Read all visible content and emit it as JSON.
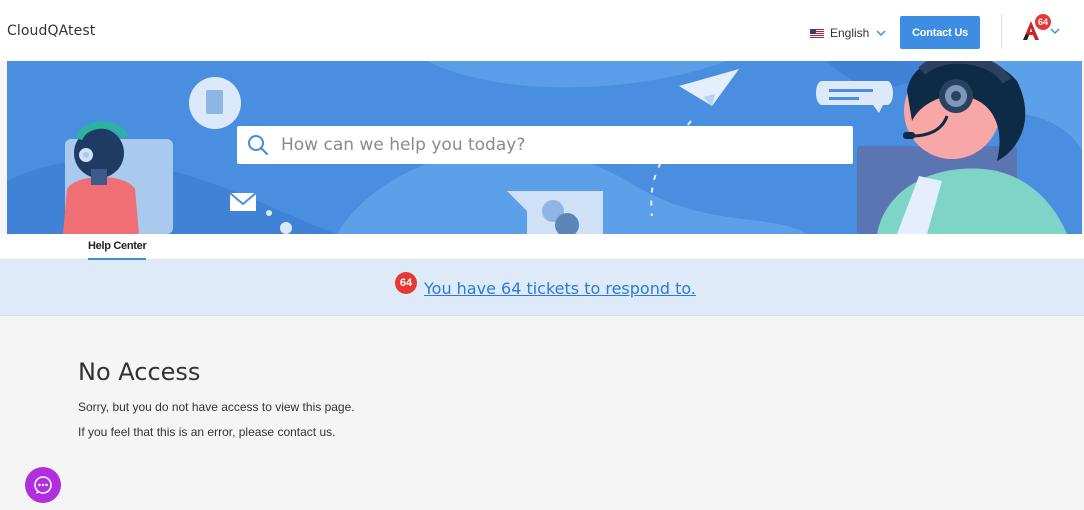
{
  "header": {
    "brand": "CloudQAtest",
    "language": "English",
    "contact_label": "Contact Us",
    "avatar_badge": "64"
  },
  "hero": {
    "search_placeholder": "How can we help you today?"
  },
  "tabs": {
    "help_center": "Help Center"
  },
  "tickets": {
    "count": "64",
    "message": "You have 64 tickets to respond to."
  },
  "content": {
    "title": "No Access",
    "line1": "Sorry, but you do not have access to view this page.",
    "line2": "If you feel that this is an error, please contact us."
  },
  "colors": {
    "accent": "#3d8ee3",
    "hero_bg": "#4a8ee0",
    "badge": "#e53935",
    "chat": "#b12ee0",
    "ticket_bar": "#dfeaf9"
  },
  "icons": [
    "flag-icon",
    "chevron-down-icon",
    "avatar-icon",
    "search-icon",
    "chat-icon"
  ]
}
